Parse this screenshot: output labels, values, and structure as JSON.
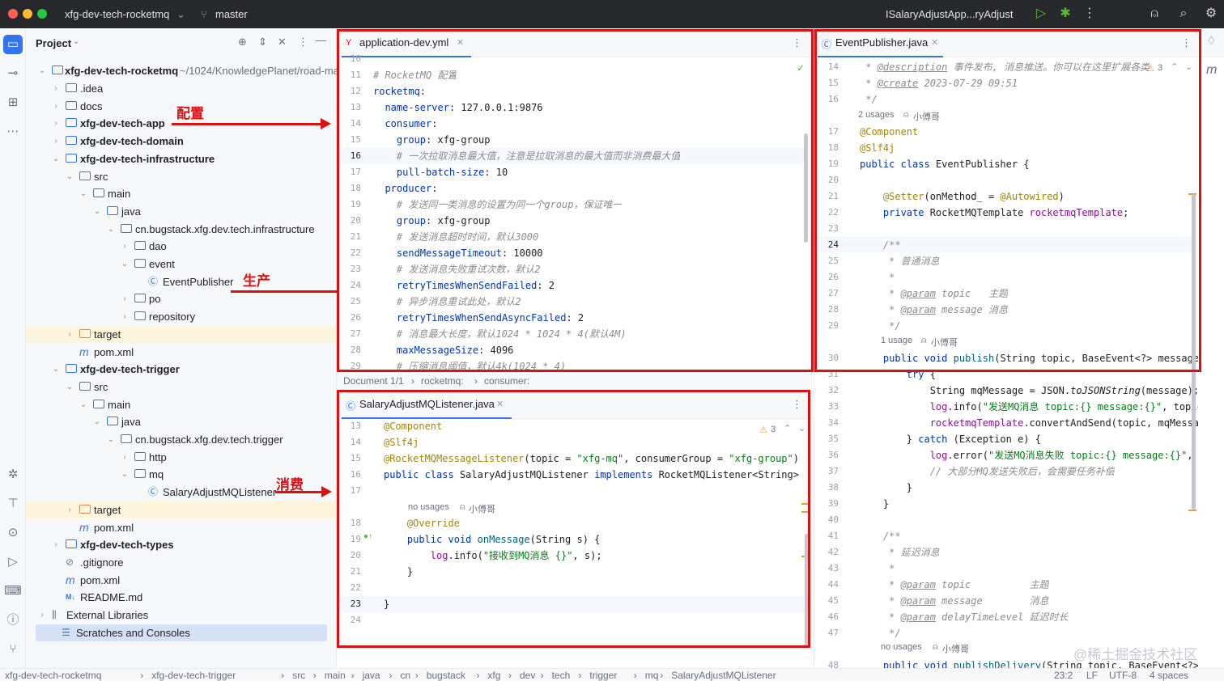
{
  "titlebar": {
    "project_name": "xfg-dev-tech-rocketmq",
    "branch": "master",
    "run_config": "ISalaryAdjustApp...ryAdjust"
  },
  "project_panel": {
    "title": "Project",
    "root_name": "xfg-dev-tech-rocketmq",
    "root_path": "~/1024/KnowledgePlanet/road-ma",
    "items": [
      {
        "label": ".idea"
      },
      {
        "label": "docs"
      },
      {
        "label": "xfg-dev-tech-app"
      },
      {
        "label": "xfg-dev-tech-domain"
      },
      {
        "label": "xfg-dev-tech-infrastructure"
      },
      {
        "label": "src"
      },
      {
        "label": "main"
      },
      {
        "label": "java"
      },
      {
        "label": "cn.bugstack.xfg.dev.tech.infrastructure"
      },
      {
        "label": "dao"
      },
      {
        "label": "event"
      },
      {
        "label": "EventPublisher"
      },
      {
        "label": "po"
      },
      {
        "label": "repository"
      },
      {
        "label": "target"
      },
      {
        "label": "pom.xml"
      },
      {
        "label": "xfg-dev-tech-trigger"
      },
      {
        "label": "src"
      },
      {
        "label": "main"
      },
      {
        "label": "java"
      },
      {
        "label": "cn.bugstack.xfg.dev.tech.trigger"
      },
      {
        "label": "http"
      },
      {
        "label": "mq"
      },
      {
        "label": "SalaryAdjustMQListener"
      },
      {
        "label": "target"
      },
      {
        "label": "pom.xml"
      },
      {
        "label": "xfg-dev-tech-types"
      },
      {
        "label": ".gitignore"
      },
      {
        "label": "pom.xml"
      },
      {
        "label": "README.md"
      },
      {
        "label": "External Libraries"
      },
      {
        "label": "Scratches and Consoles"
      }
    ]
  },
  "annotations": {
    "config": "配置",
    "produce": "生产",
    "consume": "消费"
  },
  "yml_editor": {
    "tab": "application-dev.yml",
    "breadcrumb": [
      "Document 1/1",
      "rocketmq:",
      "consumer:"
    ],
    "lines": [
      {
        "n": "10",
        "text": ""
      },
      {
        "n": "11",
        "text": "# RocketMQ 配置"
      },
      {
        "n": "12",
        "text": "rocketmq:"
      },
      {
        "n": "13",
        "text": "  name-server: 127.0.0.1:9876"
      },
      {
        "n": "14",
        "text": "  consumer:"
      },
      {
        "n": "15",
        "text": "    group: xfg-group"
      },
      {
        "n": "16",
        "text": "    # 一次拉取消息最大值，注意是拉取消息的最大值而非消费最大值"
      },
      {
        "n": "17",
        "text": "    pull-batch-size: 10"
      },
      {
        "n": "18",
        "text": "  producer:"
      },
      {
        "n": "19",
        "text": "    # 发送同一类消息的设置为同一个group，保证唯一"
      },
      {
        "n": "20",
        "text": "    group: xfg-group"
      },
      {
        "n": "21",
        "text": "    # 发送消息超时时间，默认3000"
      },
      {
        "n": "22",
        "text": "    sendMessageTimeout: 10000"
      },
      {
        "n": "23",
        "text": "    # 发送消息失败重试次数，默认2"
      },
      {
        "n": "24",
        "text": "    retryTimesWhenSendFailed: 2"
      },
      {
        "n": "25",
        "text": "    # 异步消息重试此处，默认2"
      },
      {
        "n": "26",
        "text": "    retryTimesWhenSendAsyncFailed: 2"
      },
      {
        "n": "27",
        "text": "    # 消息最大长度，默认1024 * 1024 * 4(默认4M)"
      },
      {
        "n": "28",
        "text": "    maxMessageSize: 4096"
      },
      {
        "n": "29",
        "text": "    # 压缩消息阈值，默认4k(1024 * 4)"
      }
    ]
  },
  "listener_editor": {
    "tab": "SalaryAdjustMQListener.java",
    "warnings": "3",
    "usage_hint": "no usages",
    "author_hint": "小傅哥",
    "lines": [
      {
        "n": "13",
        "text": "@Component"
      },
      {
        "n": "14",
        "text": "@Slf4j"
      },
      {
        "n": "15",
        "text": "@RocketMQMessageListener(topic = \"xfg-mq\", consumerGroup = \"xfg-group\")"
      },
      {
        "n": "16",
        "text": "public class SalaryAdjustMQListener implements RocketMQListener<String> {"
      },
      {
        "n": "17",
        "text": ""
      },
      {
        "n": "18",
        "text": "    @Override"
      },
      {
        "n": "19",
        "text": "    public void onMessage(String s) {"
      },
      {
        "n": "20",
        "text": "        log.info(\"接收到MQ消息 {}\", s);"
      },
      {
        "n": "21",
        "text": "    }"
      },
      {
        "n": "22",
        "text": ""
      },
      {
        "n": "23",
        "text": "}"
      },
      {
        "n": "24",
        "text": ""
      }
    ]
  },
  "publisher_editor": {
    "tab": "EventPublisher.java",
    "warnings": "3",
    "hints": {
      "usages2": "2 usages",
      "usage1": "1 usage",
      "nousage": "no usages",
      "author": "小傅哥"
    },
    "lines": [
      {
        "n": "14",
        "text": " * @description 事件发布, 消息推送。你可以在这里扩展各类"
      },
      {
        "n": "15",
        "text": " * @create 2023-07-29 09:51"
      },
      {
        "n": "16",
        "text": " */"
      },
      {
        "n": "17",
        "text": "@Component"
      },
      {
        "n": "18",
        "text": "@Slf4j"
      },
      {
        "n": "19",
        "text": "public class EventPublisher {"
      },
      {
        "n": "20",
        "text": ""
      },
      {
        "n": "21",
        "text": "    @Setter(onMethod_ = @Autowired)"
      },
      {
        "n": "22",
        "text": "    private RocketMQTemplate rocketmqTemplate;"
      },
      {
        "n": "23",
        "text": ""
      },
      {
        "n": "24",
        "text": "    /**"
      },
      {
        "n": "25",
        "text": "     * 普通消息"
      },
      {
        "n": "26",
        "text": "     *"
      },
      {
        "n": "27",
        "text": "     * @param topic   主题"
      },
      {
        "n": "28",
        "text": "     * @param message 消息"
      },
      {
        "n": "29",
        "text": "     */"
      },
      {
        "n": "30",
        "text": "    public void publish(String topic, BaseEvent<?> message"
      },
      {
        "n": "31",
        "text": "        try {"
      },
      {
        "n": "32",
        "text": "            String mqMessage = JSON.toJSONString(message);"
      },
      {
        "n": "33",
        "text": "            log.info(\"发送MQ消息 topic:{} message:{}\", topic"
      },
      {
        "n": "34",
        "text": "            rocketmqTemplate.convertAndSend(topic, mqMessa"
      },
      {
        "n": "35",
        "text": "        } catch (Exception e) {"
      },
      {
        "n": "36",
        "text": "            log.error(\"发送MQ消息失败 topic:{} message:{}\", t"
      },
      {
        "n": "37",
        "text": "            // 大部分MQ发送失败后，会需要任务补偿"
      },
      {
        "n": "38",
        "text": "        }"
      },
      {
        "n": "39",
        "text": "    }"
      },
      {
        "n": "40",
        "text": ""
      },
      {
        "n": "41",
        "text": "    /**"
      },
      {
        "n": "42",
        "text": "     * 延迟消息"
      },
      {
        "n": "43",
        "text": "     *"
      },
      {
        "n": "44",
        "text": "     * @param topic          主题"
      },
      {
        "n": "45",
        "text": "     * @param message        消息"
      },
      {
        "n": "46",
        "text": "     * @param delayTimeLevel 延迟时长"
      },
      {
        "n": "47",
        "text": "     */"
      },
      {
        "n": "48",
        "text": "    public void publishDelivery(String topic, BaseEvent<?>"
      }
    ]
  },
  "statusbar": {
    "path": [
      "xfg-dev-tech-rocketmq",
      "xfg-dev-tech-trigger",
      "src",
      "main",
      "java",
      "cn",
      "bugstack",
      "xfg",
      "dev",
      "tech",
      "trigger",
      "mq",
      "SalaryAdjustMQListener"
    ],
    "position": "23:2",
    "line_sep": "LF",
    "encoding": "UTF-8",
    "indent": "4 spaces"
  },
  "watermark": "@稀土掘金技术社区",
  "colors": {
    "accent": "#3574f0",
    "annotation_red": "#dd1111"
  }
}
